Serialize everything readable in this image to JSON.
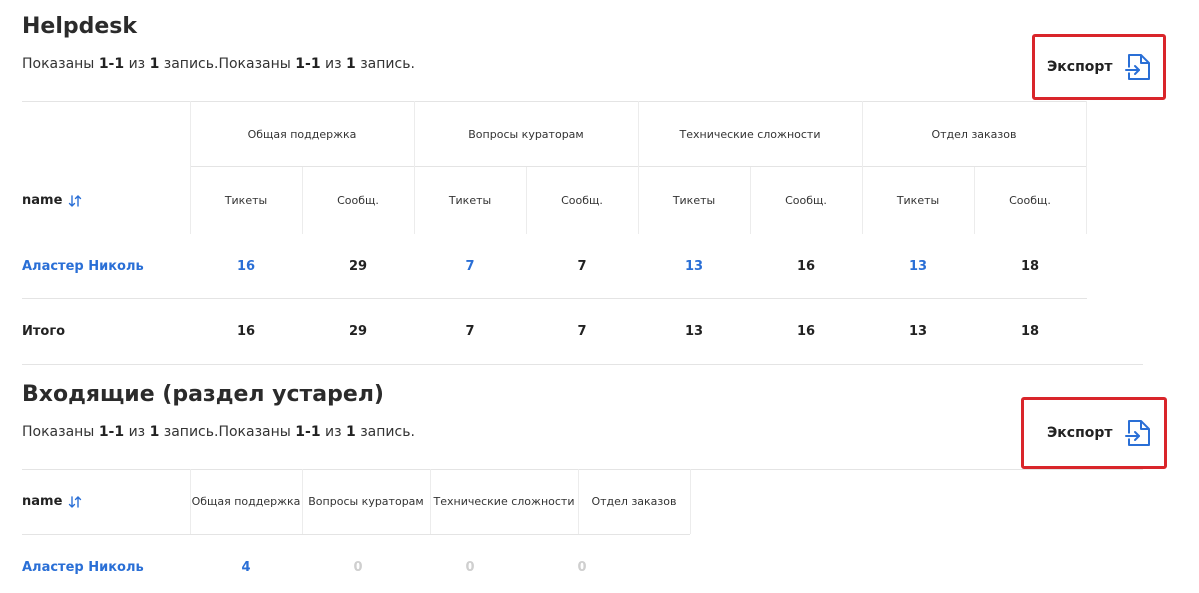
{
  "helpdesk": {
    "title": "Helpdesk",
    "summary": {
      "shown": "Показаны",
      "range": "1-1",
      "of": "из",
      "count": "1",
      "unit": "запись.",
      "shown2": "Показаны",
      "range2": "1-1",
      "of2": "из",
      "count2": "1",
      "unit2": "запись."
    },
    "export_label": "Экспорт",
    "groups": [
      "Общая поддержка",
      "Вопросы кураторам",
      "Технические сложности",
      "Отдел заказов"
    ],
    "name_header": "name",
    "sub_headers": [
      "Тикеты",
      "Сообщ.",
      "Тикеты",
      "Сообщ.",
      "Тикеты",
      "Сообщ.",
      "Тикеты",
      "Сообщ."
    ],
    "row": {
      "name": "Аластер Николь",
      "values": [
        "16",
        "29",
        "7",
        "7",
        "13",
        "16",
        "13",
        "18"
      ]
    },
    "total": {
      "label": "Итого",
      "values": [
        "16",
        "29",
        "7",
        "7",
        "13",
        "16",
        "13",
        "18"
      ]
    }
  },
  "incoming": {
    "title": "Входящие (раздел устарел)",
    "summary": {
      "shown": "Показаны",
      "range": "1-1",
      "of": "из",
      "count": "1",
      "unit": "запись.",
      "shown2": "Показаны",
      "range2": "1-1",
      "of2": "из",
      "count2": "1",
      "unit2": "запись."
    },
    "export_label": "Экспорт",
    "name_header": "name",
    "columns": [
      "Общая поддержка",
      "Вопросы кураторам",
      "Технические сложности",
      "Отдел заказов"
    ],
    "row": {
      "name": "Аластер Николь",
      "values": [
        "4",
        "0",
        "0",
        "0"
      ]
    }
  },
  "colors": {
    "link": "#2a6fd6",
    "highlight_border": "#d9252a",
    "zero_value": "#cfcfcf"
  },
  "icons": {
    "export": "file-export-icon",
    "sort": "sort-arrows-icon"
  }
}
